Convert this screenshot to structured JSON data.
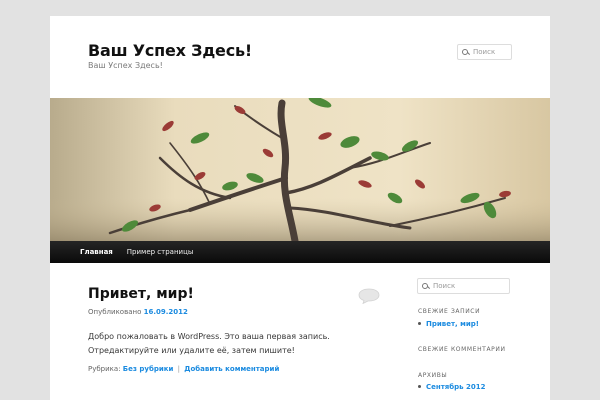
{
  "header": {
    "site_title": "Ваш Успех Здесь!",
    "site_description": "Ваш Успех Здесь!",
    "search_placeholder": "Поиск"
  },
  "banner": {
    "subject": "bonsai tree with red and green leaves"
  },
  "nav": {
    "items": [
      {
        "label": "Главная",
        "active": true
      },
      {
        "label": "Пример страницы",
        "active": false
      }
    ]
  },
  "post": {
    "title": "Привет, мир!",
    "published_prefix": "Опубликовано",
    "date": "16.09.2012",
    "body": "Добро пожаловать в WordPress. Это ваша первая запись. Отредактируйте или удалите её, затем пишите!",
    "rubric_label": "Рубрика:",
    "category": "Без рубрики",
    "separator": "|",
    "comment_link": "Добавить комментарий",
    "comment_icon": "speech-bubble-icon"
  },
  "sidebar": {
    "search_placeholder": "Поиск",
    "recent_posts_title": "СВЕЖИЕ ЗАПИСИ",
    "recent_posts": [
      "Привет, мир!"
    ],
    "recent_comments_title": "СВЕЖИЕ КОММЕНТАРИИ",
    "archives_title": "АРХИВЫ",
    "archives": [
      "Сентябрь 2012"
    ]
  },
  "colors": {
    "link": "#1b8be0",
    "nav_bg": "#0a0a0a",
    "page_bg": "#e2e2e2"
  }
}
